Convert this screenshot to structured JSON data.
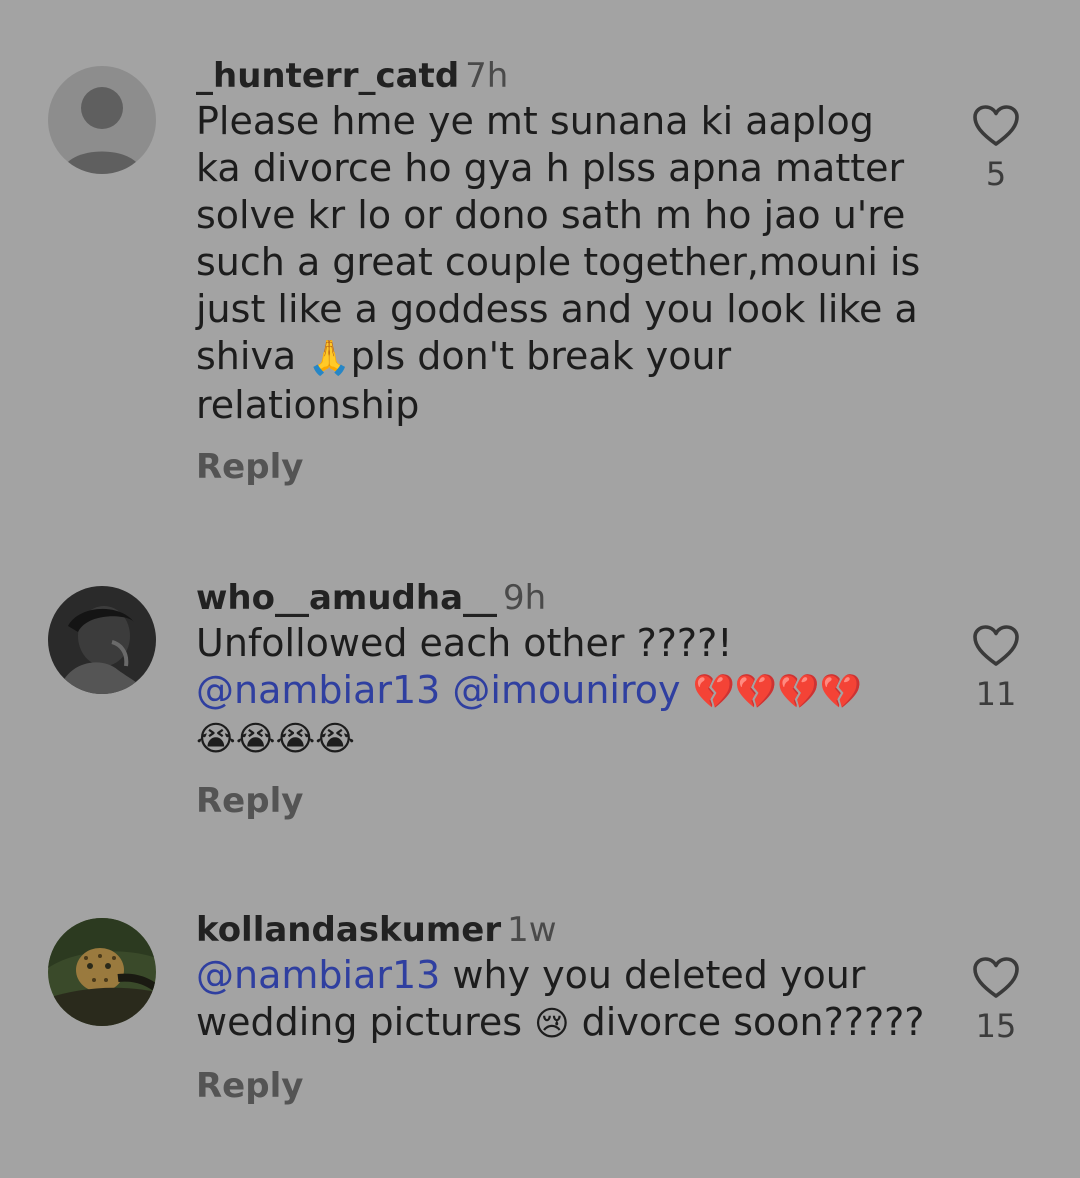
{
  "comments": [
    {
      "username": "_hunterr_catd",
      "time": "7h",
      "text_before_emoji": "Please hme ye mt sunana ki aaplog ka divorce ho gya h plss apna matter solve kr lo or dono sath m ho jao u're such a great couple together,mouni is just like a goddess and you look like a shiva ",
      "emoji": "🙏",
      "text_after_emoji": "pls don't break your relationship",
      "reply_label": "Reply",
      "like_count": "5",
      "avatar": "default-avatar-icon"
    },
    {
      "username": "who__amudha__",
      "time": "9h",
      "text_line1": "Unfollowed each other ????!",
      "mention1": "@nambiar13",
      "mention2": "@imouniroy",
      "emojis_broken": "💔💔💔💔",
      "emojis_crying": "😭😭😭😭",
      "reply_label": "Reply",
      "like_count": "11",
      "avatar": "profile-photo"
    },
    {
      "username": "kollandaskumer",
      "time": "1w",
      "mention": "@nambiar13",
      "text_part1": " why you deleted your wedding pictures ",
      "emoji": "😢",
      "text_part2": " divorce soon?????",
      "reply_label": "Reply",
      "like_count": "15",
      "avatar": "leopard-photo"
    }
  ],
  "colors": {
    "background": "#a3a3a3",
    "mention": "#2f3fa0",
    "username": "#222222"
  }
}
